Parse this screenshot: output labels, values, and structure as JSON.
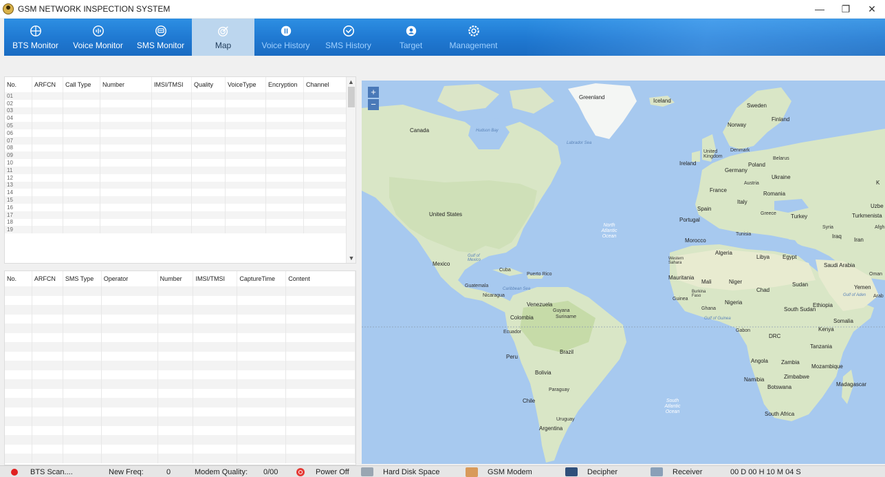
{
  "window": {
    "title": "GSM NETWORK INSPECTION SYSTEM",
    "controls": {
      "minimize": "—",
      "maximize": "❐",
      "close": "✕"
    }
  },
  "nav": {
    "items": [
      {
        "label": "BTS Monitor",
        "icon": "crosshair-icon"
      },
      {
        "label": "Voice Monitor",
        "icon": "waveform-icon"
      },
      {
        "label": "SMS Monitor",
        "icon": "message-icon"
      },
      {
        "label": "Map",
        "icon": "map-target-icon"
      },
      {
        "label": "Voice History",
        "icon": "voice-history-icon"
      },
      {
        "label": "SMS History",
        "icon": "sms-history-icon"
      },
      {
        "label": "Target",
        "icon": "target-icon"
      },
      {
        "label": "Management",
        "icon": "gear-icon"
      }
    ],
    "active": "Map"
  },
  "voice_table": {
    "columns": [
      "No.",
      "ARFCN",
      "Call Type",
      "Number",
      "IMSI/TMSI",
      "Quality",
      "VoiceType",
      "Encryption",
      "Channel"
    ],
    "rows": [
      "01",
      "02",
      "03",
      "04",
      "05",
      "06",
      "07",
      "08",
      "09",
      "10",
      "11",
      "12",
      "13",
      "14",
      "15",
      "16",
      "17",
      "18",
      "19"
    ]
  },
  "sms_table": {
    "columns": [
      "No.",
      "ARFCN",
      "SMS Type",
      "Operator",
      "Number",
      "IMSI/TMSI",
      "CaptureTime",
      "Content"
    ]
  },
  "map": {
    "zoom_in": "+",
    "zoom_out": "−",
    "labels": {
      "greenland": "Greenland",
      "iceland": "Iceland",
      "canada": "Canada",
      "hudson_bay": "Hudson Bay",
      "labrador_sea": "Labrador Sea",
      "united_states": "United States",
      "mexico": "Mexico",
      "gulf_of_mexico": "Gulf of Mexico",
      "cuba": "Cuba",
      "puerto_rico": "Puerto Rico",
      "caribbean_sea": "Caribbean Sea",
      "guatemala": "Guatemala",
      "nicaragua": "Nicaragua",
      "venezuela": "Venezuela",
      "colombia": "Colombia",
      "guyana": "Guyana",
      "suriname": "Suriname",
      "ecuador": "Ecuador",
      "peru": "Peru",
      "brazil": "Brazil",
      "bolivia": "Bolivia",
      "paraguay": "Paraguay",
      "chile": "Chile",
      "uruguay": "Uruguay",
      "argentina": "Argentina",
      "north_atlantic": "North Atlantic Ocean",
      "south_atlantic": "South Atlantic Ocean",
      "sweden": "Sweden",
      "finland": "Finland",
      "norway": "Norway",
      "united_kingdom": "United Kingdom",
      "denmark": "Denmark",
      "ireland": "Ireland",
      "belarus": "Belarus",
      "poland": "Poland",
      "germany": "Germany",
      "ukraine": "Ukraine",
      "austria": "Austria",
      "france": "France",
      "romania": "Romania",
      "italy": "Italy",
      "spain": "Spain",
      "portugal": "Portugal",
      "greece": "Greece",
      "turkey": "Turkey",
      "turkmenistan": "Turkmenista",
      "uzbe": "Uzbe",
      "syria": "Syria",
      "iraq": "Iraq",
      "iran": "Iran",
      "afgh": "Afgh",
      "tunisia": "Tunisia",
      "morocco": "Morocco",
      "algeria": "Algeria",
      "libya": "Libya",
      "egypt": "Egypt",
      "western_sahara": "Western Sahara",
      "saudi_arabia": "Saudi Arabia",
      "oman": "Oman",
      "yemen": "Yemen",
      "mauritania": "Mauritania",
      "mali": "Mali",
      "niger": "Niger",
      "chad": "Chad",
      "sudan": "Sudan",
      "guinea": "Guinea",
      "burkina_faso": "Burkina Faso",
      "nigeria": "Nigeria",
      "ghana": "Ghana",
      "ethiopia": "Ethiopia",
      "south_sudan": "South Sudan",
      "somalia": "Somalia",
      "gulf_of_guinea": "Gulf of Guinea",
      "gabon": "Gabon",
      "kenya": "Kenya",
      "drc": "DRC",
      "tanzania": "Tanzania",
      "angola": "Angola",
      "zambia": "Zambia",
      "mozambique": "Mozambique",
      "namibia": "Namibia",
      "zimbabwe": "Zimbabwe",
      "botswana": "Botswana",
      "madagascar": "Madagascar",
      "south_africa": "South Africa",
      "gulf_of_aden": "Gulf of Aden",
      "k": "K",
      "arab": "Arab"
    }
  },
  "status": {
    "scan_text": "BTS Scan....",
    "new_freq_label": "New Freq:",
    "new_freq_value": "0",
    "modem_quality_label": "Modem Quality:",
    "modem_quality_value": "0/00",
    "power_label": "Power Off",
    "hdd_label": "Hard Disk Space",
    "gsm_modem_label": "GSM Modem",
    "decipher_label": "Decipher",
    "receiver_label": "Receiver",
    "uptime": "00 D 00 H 10 M 04 S"
  },
  "colors": {
    "nav_blue": "#1f78d1",
    "nav_active": "#bcd6ee",
    "ocean": "#a7c9ef",
    "land": "#d9e6c6",
    "alert_red": "#e02020"
  }
}
